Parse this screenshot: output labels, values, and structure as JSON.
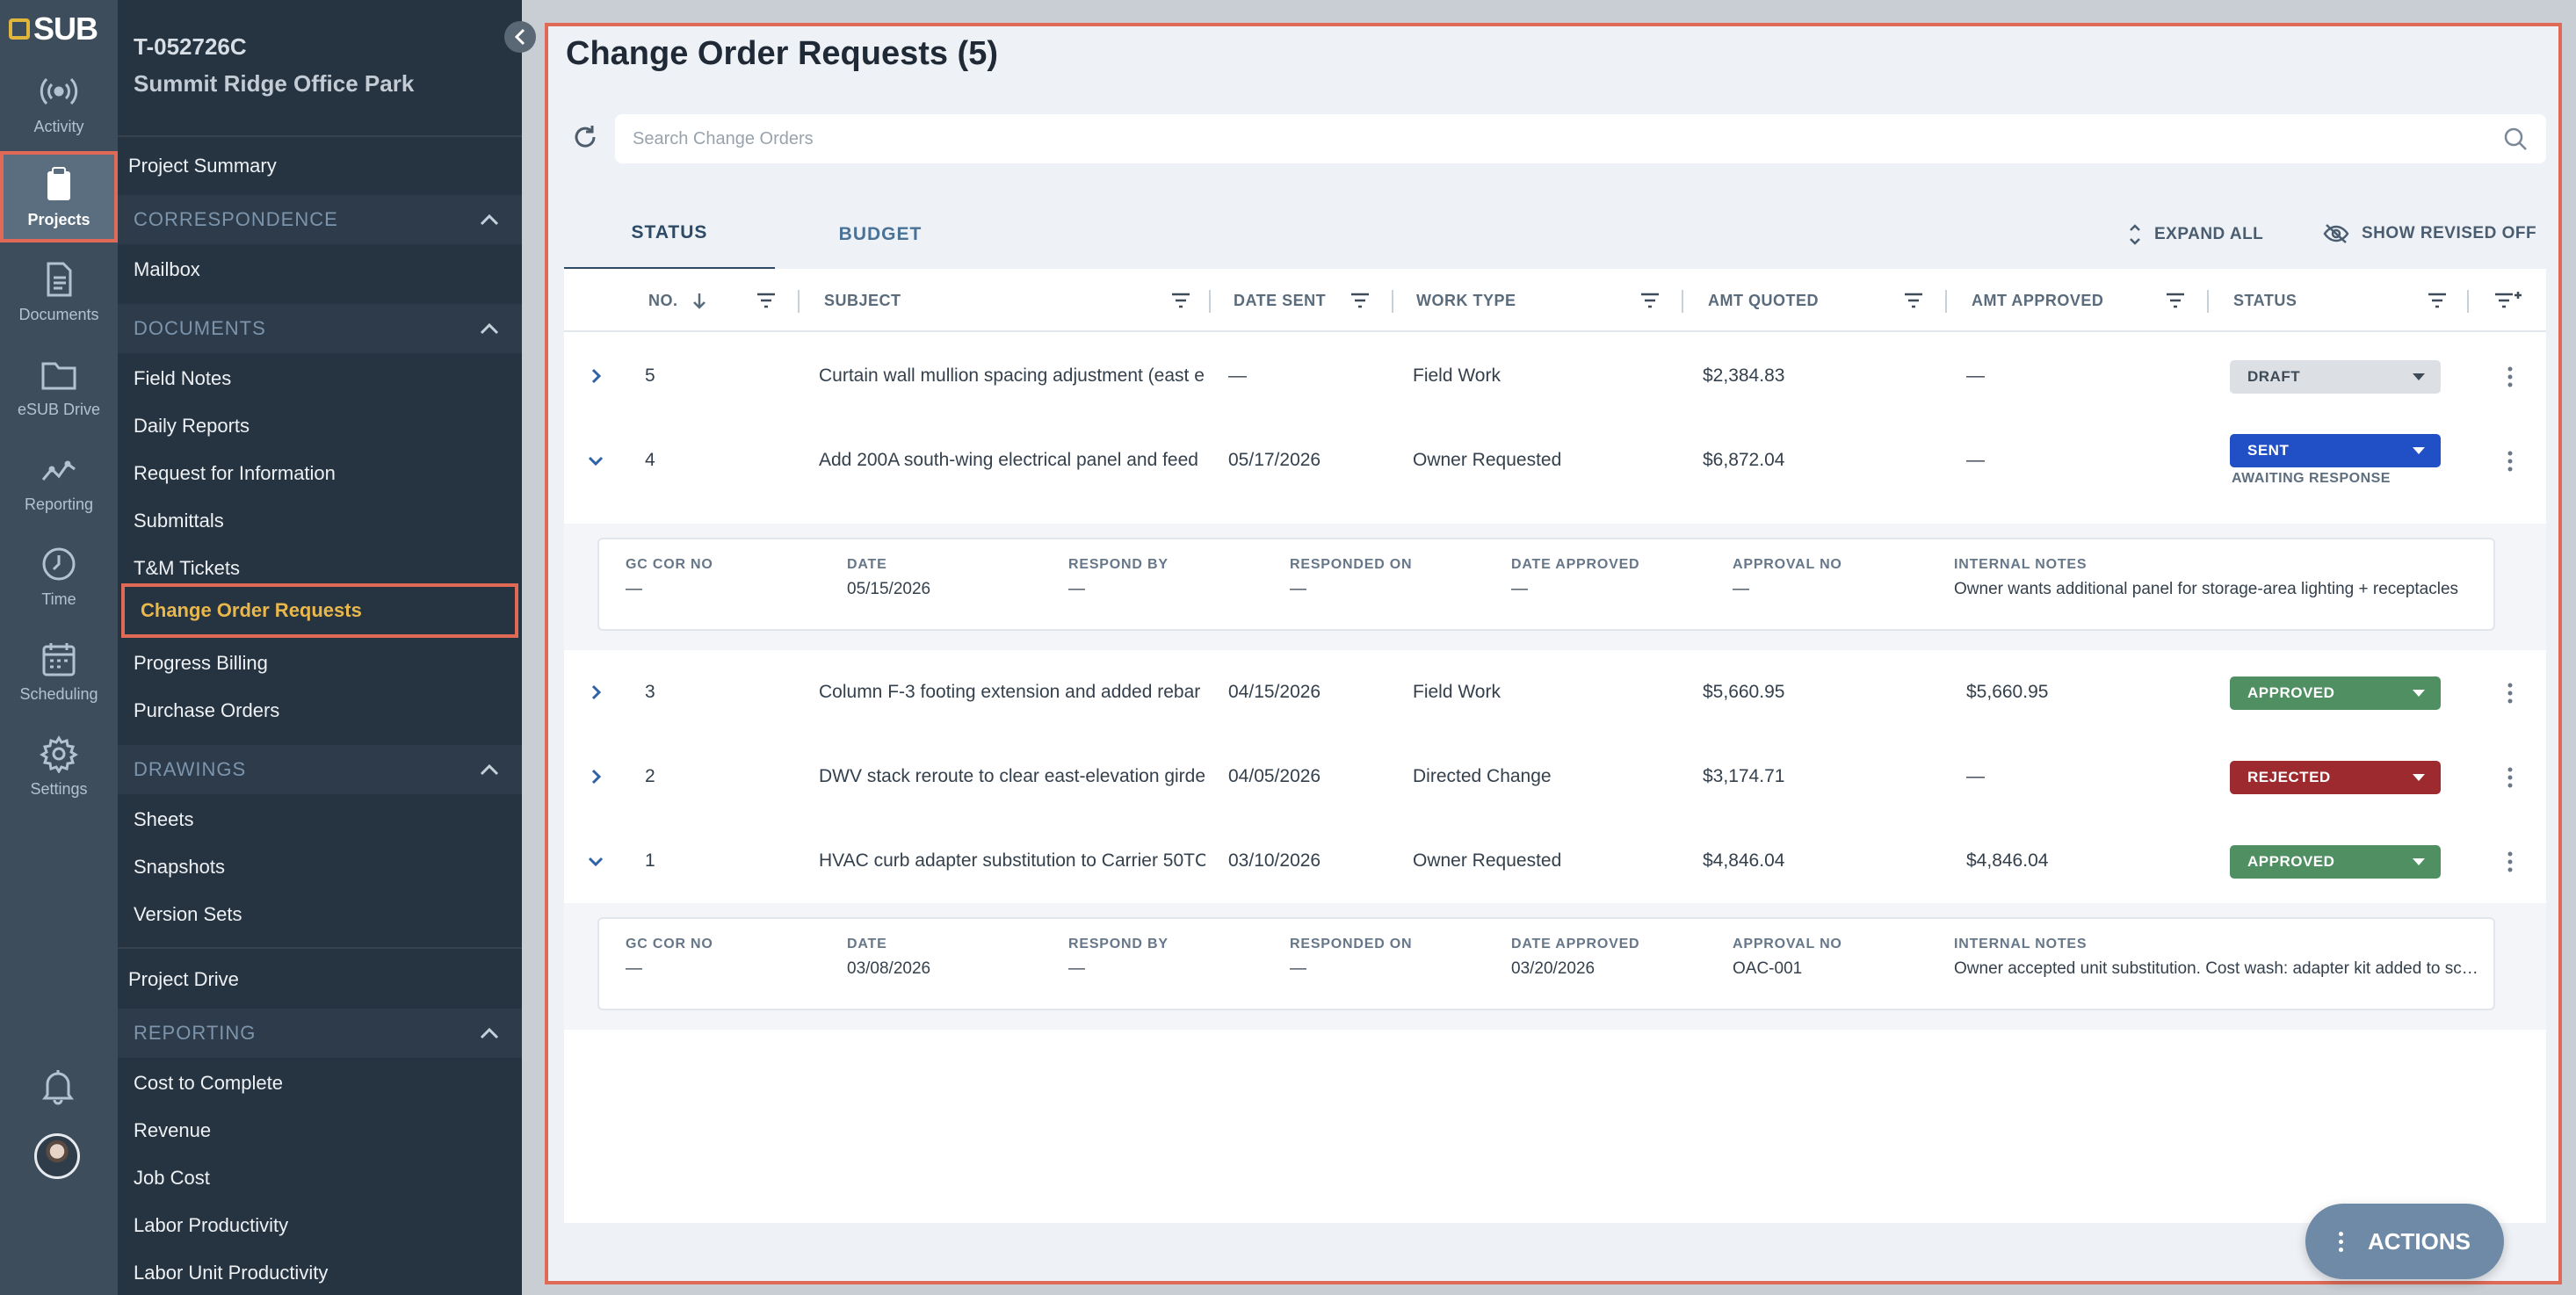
{
  "rail": {
    "logo": "SUB",
    "items": [
      {
        "label": "Activity",
        "icon": "activity-icon"
      },
      {
        "label": "Projects",
        "icon": "clipboard-icon"
      },
      {
        "label": "Documents",
        "icon": "document-icon"
      },
      {
        "label": "eSUB Drive",
        "icon": "folder-icon"
      },
      {
        "label": "Reporting",
        "icon": "chart-icon"
      },
      {
        "label": "Time",
        "icon": "clock-icon"
      },
      {
        "label": "Scheduling",
        "icon": "calendar-icon"
      },
      {
        "label": "Settings",
        "icon": "gear-icon"
      }
    ]
  },
  "project": {
    "id": "T-052726C",
    "name": "Summit Ridge Office Park"
  },
  "sidebar": {
    "project_summary": "Project Summary",
    "correspondence": {
      "header": "CORRESPONDENCE",
      "items": [
        "Mailbox"
      ]
    },
    "documents": {
      "header": "DOCUMENTS",
      "items": [
        "Field Notes",
        "Daily Reports",
        "Request for Information",
        "Submittals",
        "T&M Tickets",
        "Change Order Requests",
        "Progress Billing",
        "Purchase Orders"
      ]
    },
    "drawings": {
      "header": "DRAWINGS",
      "items": [
        "Sheets",
        "Snapshots",
        "Version Sets"
      ]
    },
    "project_drive": "Project Drive",
    "reporting": {
      "header": "REPORTING",
      "items": [
        "Cost to Complete",
        "Revenue",
        "Job Cost",
        "Labor Productivity",
        "Labor Unit Productivity"
      ]
    }
  },
  "main": {
    "title": "Change Order Requests (5)",
    "search_placeholder": "Search Change Orders",
    "tabs": [
      "STATUS",
      "BUDGET"
    ],
    "expand_all": "EXPAND ALL",
    "show_revised": "SHOW REVISED OFF",
    "actions": "ACTIONS"
  },
  "table": {
    "columns": [
      "NO.",
      "SUBJECT",
      "DATE SENT",
      "WORK TYPE",
      "AMT QUOTED",
      "AMT APPROVED",
      "STATUS"
    ],
    "rows": [
      {
        "no": "5",
        "subject": "Curtain wall mullion spacing adjustment (east e",
        "date_sent": "—",
        "work_type": "Field Work",
        "amt_quoted": "$2,384.83",
        "amt_approved": "—",
        "status": "DRAFT",
        "status_color": "#dcdfe3",
        "status_text_color": "#3d4a57",
        "expanded": false
      },
      {
        "no": "4",
        "subject": "Add 200A south-wing electrical panel and feed",
        "date_sent": "05/17/2026",
        "work_type": "Owner Requested",
        "amt_quoted": "$6,872.04",
        "amt_approved": "—",
        "status": "SENT",
        "status_color": "#2150c6",
        "status_text_color": "#ffffff",
        "substatus": "AWAITING RESPONSE",
        "expanded": true
      },
      {
        "no": "3",
        "subject": "Column F-3 footing extension and added rebar",
        "date_sent": "04/15/2026",
        "work_type": "Field Work",
        "amt_quoted": "$5,660.95",
        "amt_approved": "$5,660.95",
        "status": "APPROVED",
        "status_color": "#4f8f62",
        "status_text_color": "#ffffff",
        "expanded": false
      },
      {
        "no": "2",
        "subject": "DWV stack reroute to clear east-elevation girder",
        "date_sent": "04/05/2026",
        "work_type": "Directed Change",
        "amt_quoted": "$3,174.71",
        "amt_approved": "—",
        "status": "REJECTED",
        "status_color": "#9c2a2e",
        "status_text_color": "#ffffff",
        "expanded": false
      },
      {
        "no": "1",
        "subject": "HVAC curb adapter substitution to Carrier 50TC",
        "date_sent": "03/10/2026",
        "work_type": "Owner Requested",
        "amt_quoted": "$4,846.04",
        "amt_approved": "$4,846.04",
        "status": "APPROVED",
        "status_color": "#4f8f62",
        "status_text_color": "#ffffff",
        "expanded": true
      }
    ],
    "detail_labels": [
      "GC COR NO",
      "DATE",
      "RESPOND BY",
      "RESPONDED ON",
      "DATE APPROVED",
      "APPROVAL NO",
      "INTERNAL NOTES"
    ],
    "details": {
      "row4": [
        "—",
        "05/15/2026",
        "—",
        "—",
        "—",
        "—",
        "Owner wants additional panel for storage-area lighting + receptacles"
      ],
      "row1": [
        "—",
        "03/08/2026",
        "—",
        "—",
        "03/20/2026",
        "OAC-001",
        "Owner accepted unit substitution. Cost wash: adapter kit added to scope"
      ]
    }
  }
}
